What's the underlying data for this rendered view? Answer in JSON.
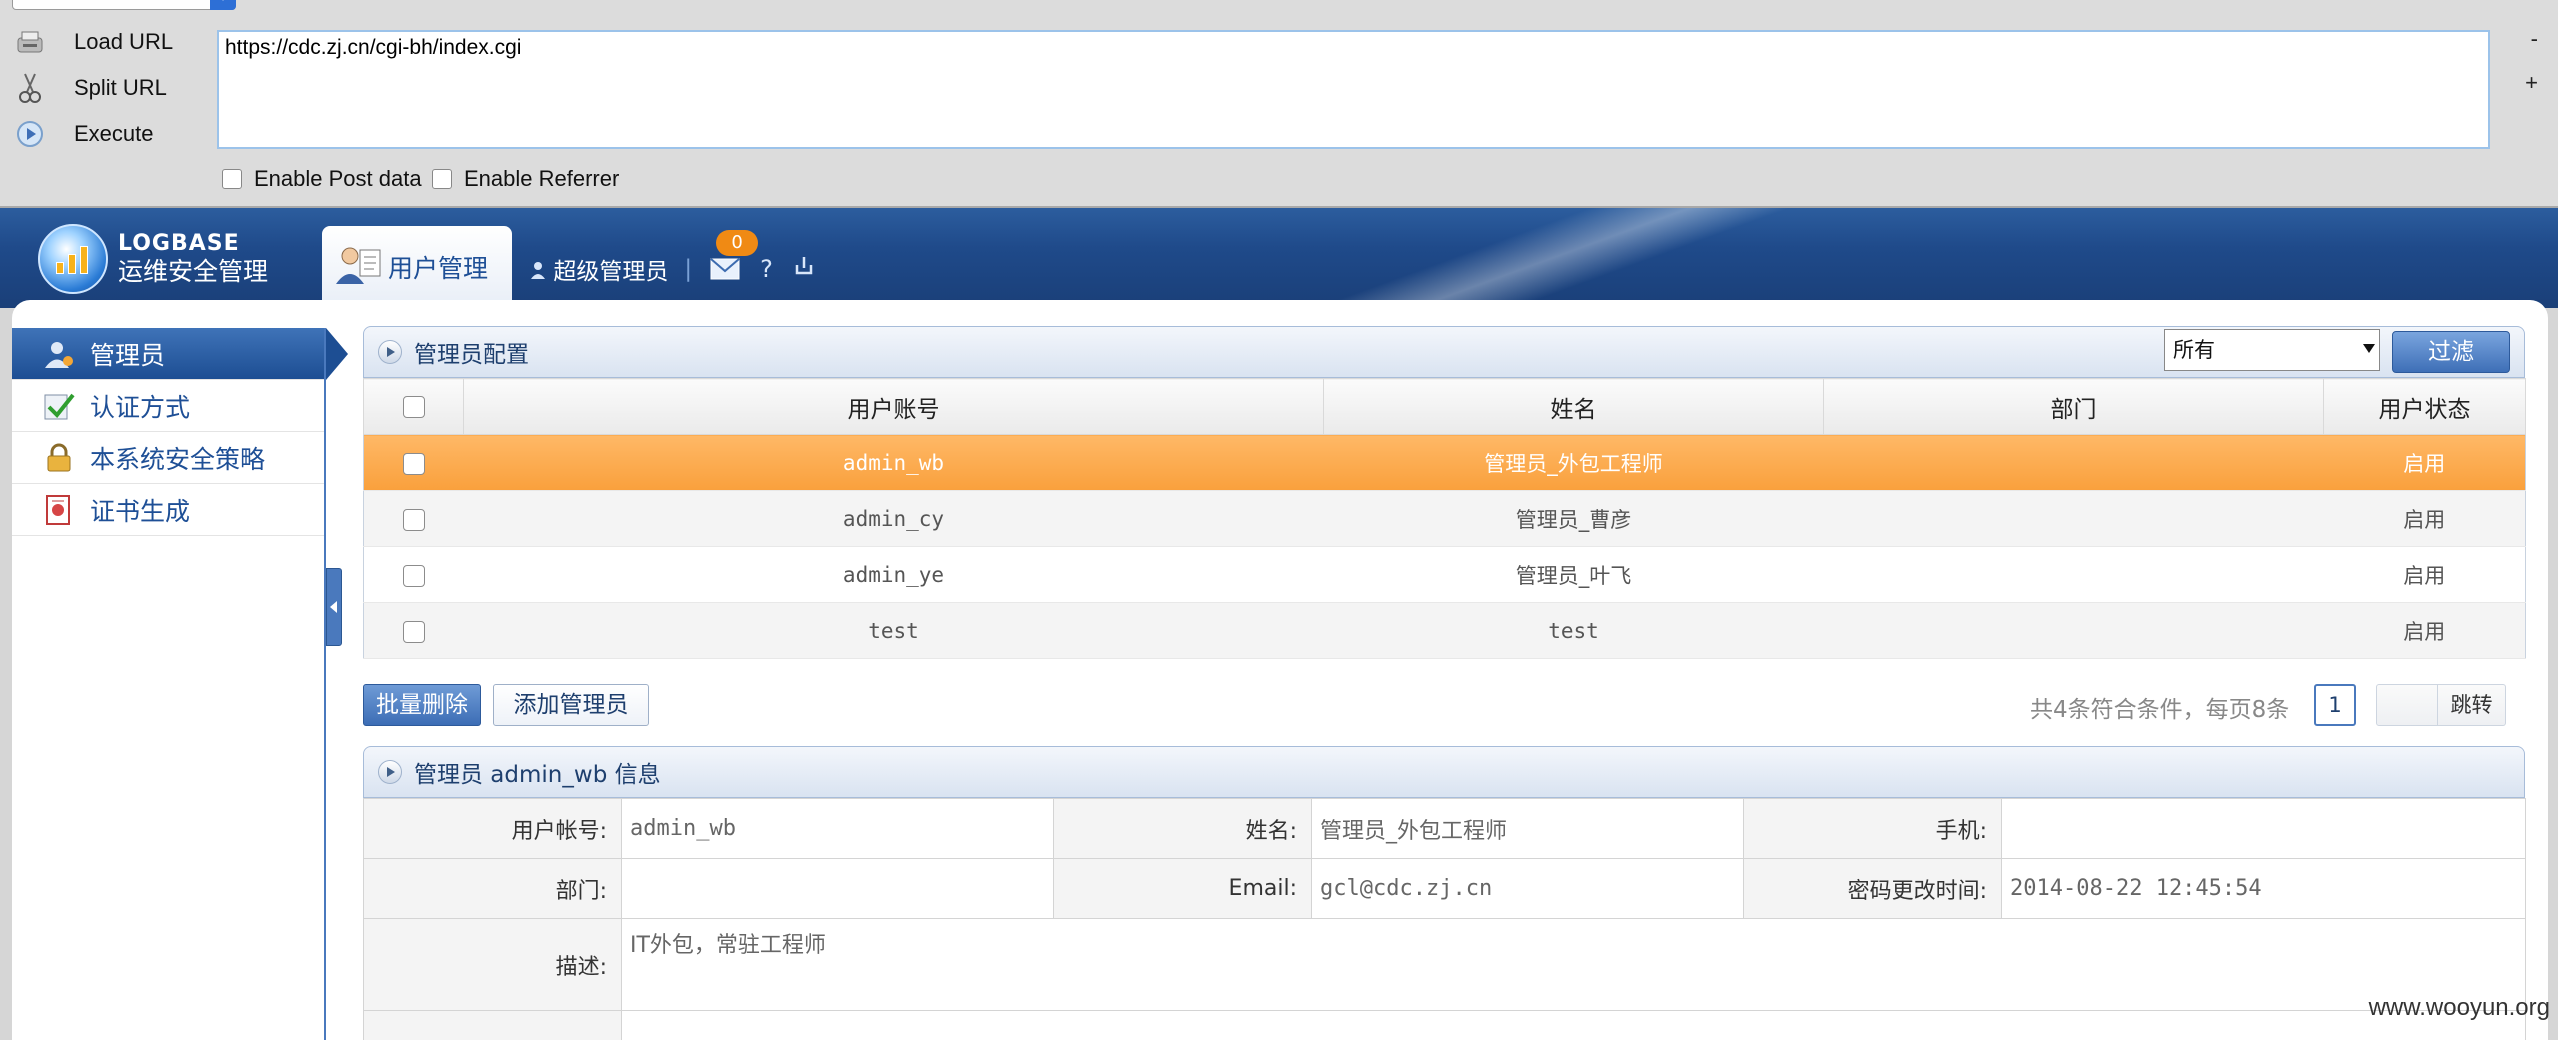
{
  "hackbar": {
    "load_url": "Load URL",
    "split_url": "Split URL",
    "execute": "Execute",
    "url_value": "https://cdc.zj.cn/cgi-bh/index.cgi",
    "minus": "-",
    "plus": "+",
    "enable_post": "Enable Post data",
    "enable_referrer": "Enable Referrer"
  },
  "header": {
    "logo_line1": "LOGBASE",
    "logo_line2": "运维安全管理",
    "tab_active": "用户管理",
    "super_admin": "超级管理员",
    "sep": "|",
    "mail_count": "0",
    "help": "?"
  },
  "sidebar": {
    "items": [
      {
        "label": "管理员",
        "icon": "admin-user-icon",
        "active": true
      },
      {
        "label": "认证方式",
        "icon": "auth-check-icon",
        "active": false
      },
      {
        "label": "本系统安全策略",
        "icon": "lock-icon",
        "active": false
      },
      {
        "label": "证书生成",
        "icon": "certificate-icon",
        "active": false
      }
    ]
  },
  "admin_config": {
    "title": "管理员配置",
    "filter_value": "所有",
    "filter_button": "过滤",
    "columns": [
      "用户账号",
      "姓名",
      "部门",
      "用户状态"
    ],
    "rows": [
      {
        "account": "admin_wb",
        "name": "管理员_外包工程师",
        "dept": "",
        "status": "启用"
      },
      {
        "account": "admin_cy",
        "name": "管理员_曹彦",
        "dept": "",
        "status": "启用"
      },
      {
        "account": "admin_ye",
        "name": "管理员_叶飞",
        "dept": "",
        "status": "启用"
      },
      {
        "account": "test",
        "name": "test",
        "dept": "",
        "status": "启用"
      }
    ],
    "batch_delete": "批量删除",
    "add_admin": "添加管理员",
    "pager_text": "共4条符合条件，每页8条",
    "page": "1",
    "jump": "跳转"
  },
  "admin_info": {
    "title": "管理员 admin_wb 信息",
    "labels": {
      "account": "用户帐号:",
      "name": "姓名:",
      "phone": "手机:",
      "dept": "部门:",
      "email": "Email:",
      "pwd_time": "密码更改时间:",
      "desc": "描述:"
    },
    "values": {
      "account": "admin_wb",
      "name": "管理员_外包工程师",
      "phone": "",
      "dept": "",
      "email": "gcl@cdc.zj.cn",
      "pwd_time": "2014-08-22 12:45:54",
      "desc": "IT外包，常驻工程师"
    }
  },
  "watermark": "www.wooyun.org",
  "colors": {
    "header_blue": "#1f4a8a",
    "selected_row": "#f9a03c",
    "badge_orange": "#f08a14",
    "accent_blue": "#3c6db5"
  }
}
